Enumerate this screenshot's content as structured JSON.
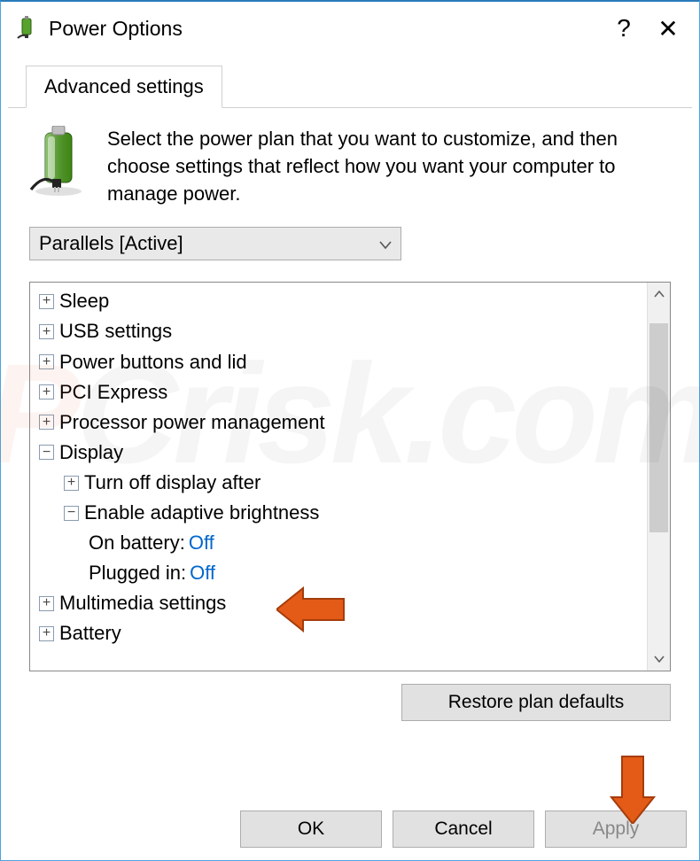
{
  "window": {
    "title": "Power Options"
  },
  "tabs": {
    "advanced": "Advanced settings"
  },
  "intro": "Select the power plan that you want to customize, and then choose settings that reflect how you want your computer to manage power.",
  "plan_selector": {
    "selected": "Parallels [Active]"
  },
  "tree": {
    "sleep": "Sleep",
    "usb": "USB settings",
    "powerbtn": "Power buttons and lid",
    "pci": "PCI Express",
    "proc": "Processor power management",
    "display": "Display",
    "turnoff": "Turn off display after",
    "adaptive": "Enable adaptive brightness",
    "on_battery_label": "On battery:",
    "on_battery_value": "Off",
    "plugged_label": "Plugged in:",
    "plugged_value": "Off",
    "multimedia": "Multimedia settings",
    "battery": "Battery"
  },
  "buttons": {
    "restore": "Restore plan defaults",
    "ok": "OK",
    "cancel": "Cancel",
    "apply": "Apply"
  },
  "icons": {
    "expand": "+",
    "collapse": "−",
    "help": "?",
    "close": "✕"
  }
}
